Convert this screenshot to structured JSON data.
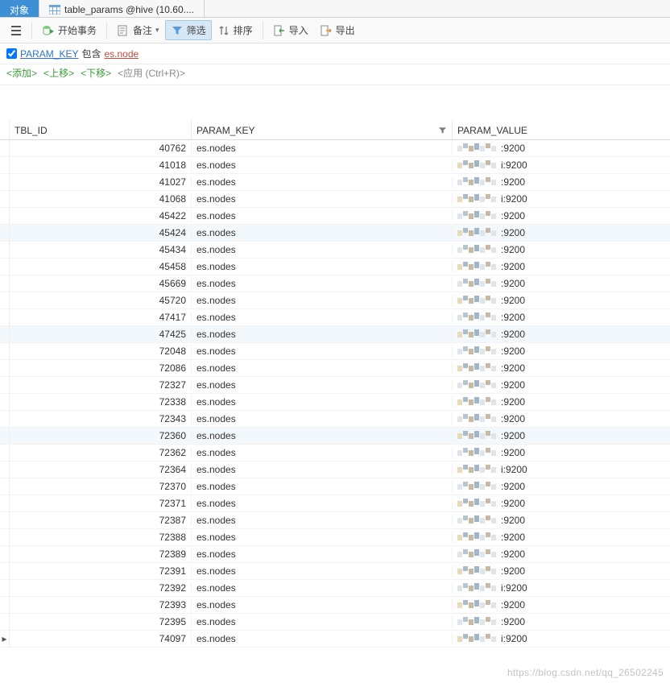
{
  "tabs": {
    "objects": "对象",
    "data": "table_params @hive (10.60...."
  },
  "toolbar": {
    "begin_txn": "开始事务",
    "memo": "备注",
    "filter": "筛选",
    "sort": "排序",
    "import": "导入",
    "export": "导出"
  },
  "filterbar": {
    "field_link": "PARAM_KEY",
    "op": "包含",
    "value_link": "es.node"
  },
  "filteractions": {
    "add": "添加",
    "up": "上移",
    "down": "下移",
    "apply": "应用 (Ctrl+R)"
  },
  "columns": {
    "tbl_id": "TBL_ID",
    "param_key": "PARAM_KEY",
    "param_value": "PARAM_VALUE"
  },
  "rows": [
    {
      "id": "40762",
      "key": "es.nodes",
      "val": ":9200"
    },
    {
      "id": "41018",
      "key": "es.nodes",
      "val": "i:9200"
    },
    {
      "id": "41027",
      "key": "es.nodes",
      "val": ":9200"
    },
    {
      "id": "41068",
      "key": "es.nodes",
      "val": "i:9200"
    },
    {
      "id": "45422",
      "key": "es.nodes",
      "val": ":9200"
    },
    {
      "id": "45424",
      "key": "es.nodes",
      "val": ":9200"
    },
    {
      "id": "45434",
      "key": "es.nodes",
      "val": ":9200"
    },
    {
      "id": "45458",
      "key": "es.nodes",
      "val": ":9200"
    },
    {
      "id": "45669",
      "key": "es.nodes",
      "val": ":9200"
    },
    {
      "id": "45720",
      "key": "es.nodes",
      "val": ":9200"
    },
    {
      "id": "47417",
      "key": "es.nodes",
      "val": ":9200"
    },
    {
      "id": "47425",
      "key": "es.nodes",
      "val": ":9200"
    },
    {
      "id": "72048",
      "key": "es.nodes",
      "val": ":9200"
    },
    {
      "id": "72086",
      "key": "es.nodes",
      "val": ":9200"
    },
    {
      "id": "72327",
      "key": "es.nodes",
      "val": ":9200"
    },
    {
      "id": "72338",
      "key": "es.nodes",
      "val": ":9200"
    },
    {
      "id": "72343",
      "key": "es.nodes",
      "val": ":9200"
    },
    {
      "id": "72360",
      "key": "es.nodes",
      "val": ":9200"
    },
    {
      "id": "72362",
      "key": "es.nodes",
      "val": ":9200"
    },
    {
      "id": "72364",
      "key": "es.nodes",
      "val": "i:9200"
    },
    {
      "id": "72370",
      "key": "es.nodes",
      "val": ":9200"
    },
    {
      "id": "72371",
      "key": "es.nodes",
      "val": ":9200"
    },
    {
      "id": "72387",
      "key": "es.nodes",
      "val": ":9200"
    },
    {
      "id": "72388",
      "key": "es.nodes",
      "val": ":9200"
    },
    {
      "id": "72389",
      "key": "es.nodes",
      "val": ":9200"
    },
    {
      "id": "72391",
      "key": "es.nodes",
      "val": ":9200"
    },
    {
      "id": "72392",
      "key": "es.nodes",
      "val": "i:9200"
    },
    {
      "id": "72393",
      "key": "es.nodes",
      "val": ":9200"
    },
    {
      "id": "72395",
      "key": "es.nodes",
      "val": ":9200"
    },
    {
      "id": "74097",
      "key": "es.nodes",
      "val": "i:9200"
    }
  ],
  "alt_rows": [
    5,
    11,
    17
  ],
  "current_row_index": 29,
  "watermark": "https://blog.csdn.net/qq_26502245"
}
